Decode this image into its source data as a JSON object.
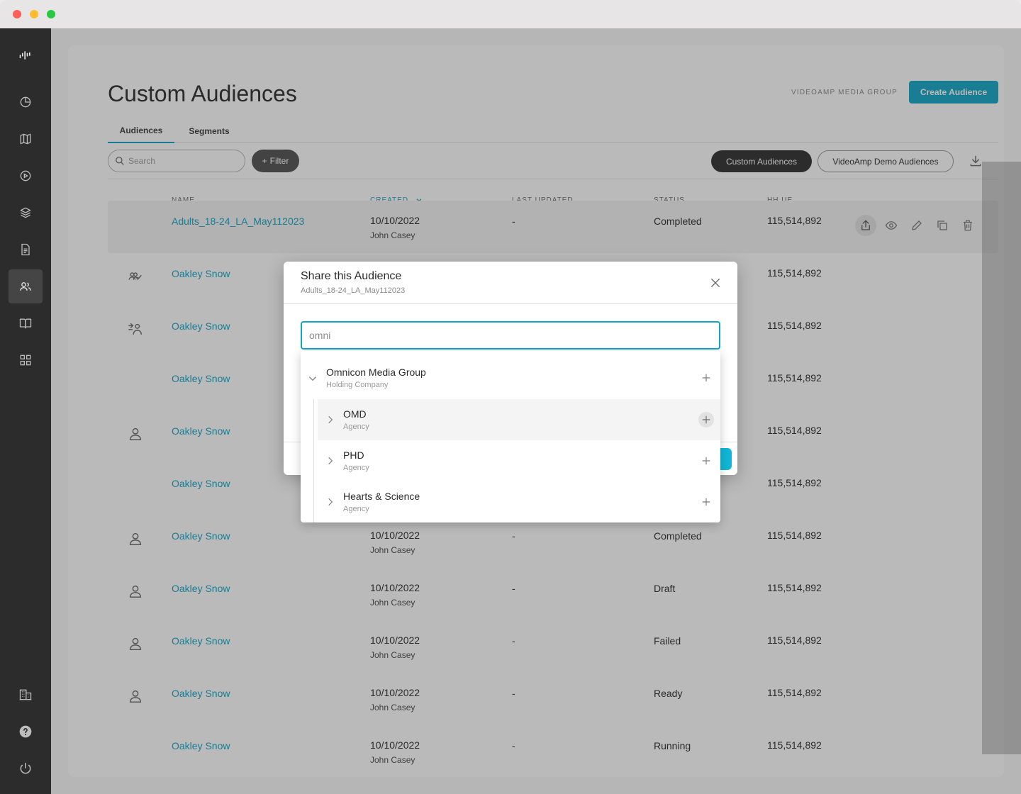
{
  "page": {
    "title": "Custom Audiences",
    "org_label": "VIDEOAMP MEDIA GROUP",
    "create_button": "Create Audience"
  },
  "tabs": [
    {
      "label": "Audiences",
      "active": true
    },
    {
      "label": "Segments",
      "active": false
    }
  ],
  "toolbar": {
    "search_placeholder": "Search",
    "filter_label": "Filter",
    "pill_custom": "Custom Audiences",
    "pill_demo": "VideoAmp Demo Audiences"
  },
  "table": {
    "headers": {
      "name": "NAME",
      "created": "CREATED",
      "last_updated": "LAST UPDATED",
      "status": "STATUS",
      "hh_ue": "HH UE"
    },
    "rows": [
      {
        "name": "Adults_18-24_LA_May112023",
        "created": "10/10/2022",
        "by": "John Casey",
        "updated": "-",
        "status": "Completed",
        "hh": "115,514,892",
        "icon": "none"
      },
      {
        "name": "Oakley Snow",
        "created": "",
        "by": "",
        "updated": "",
        "status": "",
        "hh": "115,514,892",
        "icon": "users-check-icon"
      },
      {
        "name": "Oakley Snow",
        "created": "",
        "by": "",
        "updated": "",
        "status": "",
        "hh": "115,514,892",
        "icon": "user-share-icon"
      },
      {
        "name": "Oakley Snow",
        "created": "",
        "by": "",
        "updated": "",
        "status": "",
        "hh": "115,514,892",
        "icon": "none"
      },
      {
        "name": "Oakley Snow",
        "created": "",
        "by": "",
        "updated": "",
        "status": "",
        "hh": "115,514,892",
        "icon": "user-icon"
      },
      {
        "name": "Oakley Snow",
        "created": "",
        "by": "",
        "updated": "",
        "status": "",
        "hh": "115,514,892",
        "icon": "none"
      },
      {
        "name": "Oakley Snow",
        "created": "10/10/2022",
        "by": "John Casey",
        "updated": "-",
        "status": "Completed",
        "hh": "115,514,892",
        "icon": "user-icon"
      },
      {
        "name": "Oakley Snow",
        "created": "10/10/2022",
        "by": "John Casey",
        "updated": "-",
        "status": "Draft",
        "hh": "115,514,892",
        "icon": "user-icon"
      },
      {
        "name": "Oakley Snow",
        "created": "10/10/2022",
        "by": "John Casey",
        "updated": "-",
        "status": "Failed",
        "hh": "115,514,892",
        "icon": "user-icon"
      },
      {
        "name": "Oakley Snow",
        "created": "10/10/2022",
        "by": "John Casey",
        "updated": "-",
        "status": "Ready",
        "hh": "115,514,892",
        "icon": "user-icon"
      },
      {
        "name": "Oakley Snow",
        "created": "10/10/2022",
        "by": "John Casey",
        "updated": "-",
        "status": "Running",
        "hh": "115,514,892",
        "icon": "none"
      }
    ]
  },
  "modal": {
    "title": "Share this Audience",
    "subtitle": "Adults_18-24_LA_May112023",
    "search_value": "omni",
    "results": [
      {
        "name": "Omnicon Media Group",
        "type": "Holding Company",
        "expanded": true
      },
      {
        "name": "OMD",
        "type": "Agency",
        "expanded": false
      },
      {
        "name": "PHD",
        "type": "Agency",
        "expanded": false
      },
      {
        "name": "Hearts & Science",
        "type": "Agency",
        "expanded": false
      }
    ]
  },
  "colors": {
    "accent": "#12a5c6",
    "sidebar": "#2c2c2c",
    "overlay": "rgba(40,40,40,0.32)"
  }
}
